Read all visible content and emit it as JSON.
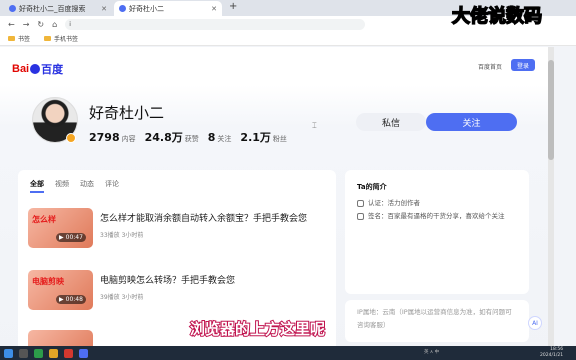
{
  "browser": {
    "tabs": [
      {
        "label": "好奇杜小二_百度搜索",
        "active": false
      },
      {
        "label": "好奇杜小二",
        "active": true
      }
    ],
    "new_tab_label": "+",
    "address_value": "i",
    "bookmarks": [
      {
        "label": "书签"
      },
      {
        "label": "手机书签"
      }
    ]
  },
  "header": {
    "logo_left": "Bai",
    "logo_right": "百度",
    "home_link": "百度首页",
    "login_label": "登录"
  },
  "profile": {
    "name": "好奇杜小二",
    "stats": [
      {
        "value": "2798",
        "label": "内容"
      },
      {
        "value": "24.8万",
        "label": "获赞"
      },
      {
        "value": "8",
        "label": "关注"
      },
      {
        "value": "2.1万",
        "label": "粉丝"
      }
    ],
    "message_label": "私信",
    "follow_label": "关注"
  },
  "content_tabs": [
    "全部",
    "视频",
    "动态",
    "评论"
  ],
  "videos": [
    {
      "thumb_text": "怎么样",
      "duration": "00:47",
      "title": "怎么样才能取消余额自动转入余额宝？手把手教会您",
      "views": "33播放",
      "time": "3小时前"
    },
    {
      "thumb_text": "电脑剪映",
      "duration": "00:48",
      "title": "电脑剪映怎么转场？手把手教会您",
      "views": "39播放",
      "time": "3小时前"
    }
  ],
  "about": {
    "title": "Ta的简介",
    "certification": "认证：活力创作者",
    "signature": "签名：百家最有逼格的干货分享，喜欢给个关注",
    "ip": "IP属地：云南（IP属地以运营商信息为准，如有问题可咨询客服）"
  },
  "ai_label": "AI",
  "overlay": {
    "watermark": "大佬说数码",
    "subtitle": "浏览器的上方这里呢"
  },
  "taskbar": {
    "tray": "英 ∧ 中",
    "clock_time": "18:56",
    "clock_date": "2024/1/21"
  },
  "colors": {
    "accent": "#4e6ef2",
    "brand_red": "#e10602",
    "subtitle_stroke": "#c0134e"
  }
}
